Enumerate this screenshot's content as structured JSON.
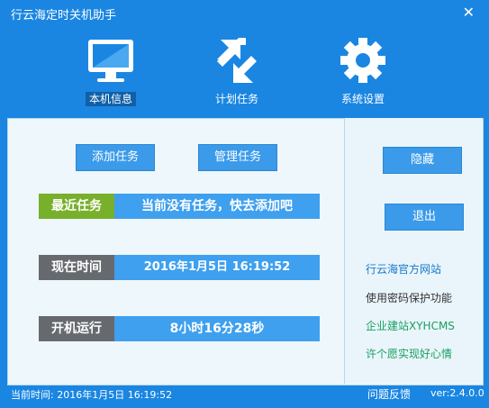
{
  "window": {
    "title": "行云海定时关机助手"
  },
  "nav": {
    "info": "本机信息",
    "plan": "计划任务",
    "settings": "系统设置"
  },
  "buttons": {
    "add": "添加任务",
    "manage": "管理任务",
    "hide": "隐藏",
    "exit": "退出"
  },
  "rows": {
    "recent_label": "最近任务",
    "recent_value": "当前没有任务，快去添加吧",
    "time_label": "现在时间",
    "time_value": "2016年1月5日  16:19:52",
    "boot_label": "开机运行",
    "boot_value": "8小时16分28秒"
  },
  "links": {
    "official": "行云海官方网站",
    "password": "使用密码保护功能",
    "site": "企业建站XYHCMS",
    "wish": "许个愿实现好心情"
  },
  "status": {
    "time": "当前时间: 2016年1月5日  16:19:52",
    "feedback": "问题反馈",
    "version": "ver:2.4.0.0"
  }
}
